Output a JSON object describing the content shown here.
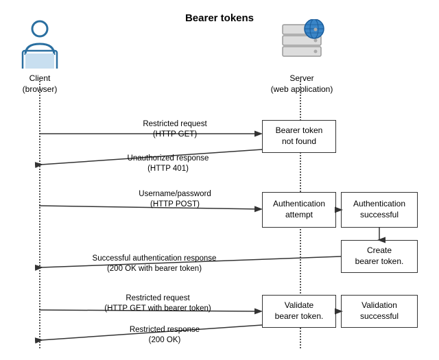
{
  "title": "Bearer tokens",
  "client": {
    "label_line1": "Client",
    "label_line2": "(browser)"
  },
  "server": {
    "label_line1": "Server",
    "label_line2": "(web application)"
  },
  "boxes": [
    {
      "id": "bearer-not-found",
      "text_line1": "Bearer token",
      "text_line2": "not found"
    },
    {
      "id": "auth-attempt",
      "text_line1": "Authentication",
      "text_line2": "attempt"
    },
    {
      "id": "auth-successful",
      "text_line1": "Authentication",
      "text_line2": "successful"
    },
    {
      "id": "create-bearer",
      "text_line1": "Create",
      "text_line2": "bearer token."
    },
    {
      "id": "validate-bearer",
      "text_line1": "Validate",
      "text_line2": "bearer token."
    },
    {
      "id": "validation-successful",
      "text_line1": "Validation",
      "text_line2": "successful"
    }
  ],
  "arrows": [
    {
      "id": "restricted-request",
      "label_line1": "Restricted request",
      "label_line2": "(HTTP GET)"
    },
    {
      "id": "unauthorized-response",
      "label_line1": "Unauthorized response",
      "label_line2": "(HTTP 401)"
    },
    {
      "id": "username-password",
      "label_line1": "Username/password",
      "label_line2": "(HTTP POST)"
    },
    {
      "id": "successful-auth-response",
      "label_line1": "Successful authentication response",
      "label_line2": "(200 OK with bearer token)"
    },
    {
      "id": "restricted-request-2",
      "label_line1": "Restricted request",
      "label_line2": "(HTTP GET with bearer token)"
    },
    {
      "id": "restricted-response",
      "label_line1": "Restricted response",
      "label_line2": "(200 OK)"
    }
  ]
}
